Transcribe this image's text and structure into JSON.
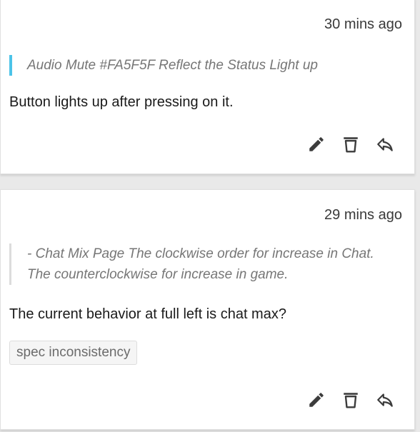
{
  "comments": [
    {
      "time": "30 mins ago",
      "quote": "Audio Mute #FA5F5F Reflect the Status Light up",
      "body": "Button lights up after pressing on it.",
      "quote_accent": "#4cc3e8"
    },
    {
      "time": "29 mins ago",
      "quote": "- Chat Mix Page The clockwise order for increase in Chat. The counterclockwise for increase in game.",
      "body": "The current behavior at full left is chat max?",
      "tag": "spec inconsistency"
    }
  ],
  "icons": {
    "edit": "pencil-icon",
    "delete": "trash-icon",
    "reply": "reply-icon"
  },
  "colors": {
    "icon": "#3c3c3c",
    "background": "#e9e9e9",
    "card": "#ffffff"
  }
}
